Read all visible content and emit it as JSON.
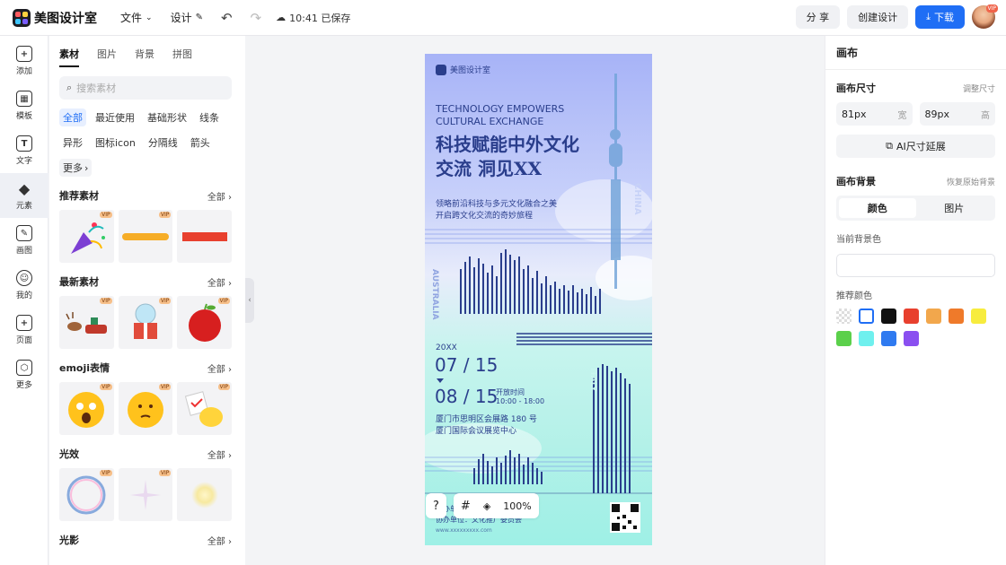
{
  "app": {
    "name": "美图设计室"
  },
  "topbar": {
    "file_label": "文件",
    "design_label": "设计",
    "saved_text": "10:41 已保存",
    "share_label": "分 享",
    "create_label": "创建设计",
    "download_label": "下载",
    "avatar_badge": "VIP"
  },
  "leftnav": {
    "items": [
      {
        "label": "添加",
        "icon": "plus-icon"
      },
      {
        "label": "模板",
        "icon": "template-icon"
      },
      {
        "label": "文字",
        "icon": "text-icon"
      },
      {
        "label": "元素",
        "icon": "shapes-icon"
      },
      {
        "label": "画图",
        "icon": "draw-icon"
      },
      {
        "label": "我的",
        "icon": "user-icon"
      },
      {
        "label": "页面",
        "icon": "page-icon"
      },
      {
        "label": "更多",
        "icon": "cube-icon"
      }
    ],
    "active": "元素"
  },
  "panel": {
    "tabs": [
      "素材",
      "图片",
      "背景",
      "拼图"
    ],
    "search_placeholder": "搜索素材",
    "chips": [
      "全部",
      "最近使用",
      "基础形状",
      "线条",
      "异形",
      "图标icon",
      "分隔线",
      "箭头",
      "更多"
    ],
    "all_label": "全部",
    "vip": "VIP",
    "sections": [
      "推荐素材",
      "最新素材",
      "emoji表情",
      "光效",
      "光影"
    ]
  },
  "canvas": {
    "poster": {
      "brand": "美图设计室",
      "en_line1": "TECHNOLOGY EMPOWERS",
      "en_line2": "CULTURAL EXCHANGE",
      "title_line1": "科技赋能中外文化",
      "title_line2": "交流  洞见XX",
      "desc_line1": "领略前沿科技与多元文化融合之美",
      "desc_line2": "开启跨文化交流的奇妙旅程",
      "side_left": "AUSTRALIA",
      "side_right": "CHINA",
      "side_mid": "ITALY",
      "year": "20XX",
      "date1": "07 / 15",
      "date2": "08 / 15",
      "time_label": "开放时间",
      "time_value": "10:00 - 18:00",
      "addr_line1": "厦门市思明区会展路 180 号",
      "addr_line2": "厦门国际会议展览中心",
      "host_line1": "主办单位：厦门文化交流协会",
      "host_line2": "协办单位：文化推广委员会",
      "small_line": "www.xxxxxxxxx.com"
    }
  },
  "zoom": {
    "value": "100%"
  },
  "help_label": "?",
  "rightpanel": {
    "title": "画布",
    "size_label": "画布尺寸",
    "resize_label": "调整尺寸",
    "width_value": "81px",
    "width_unit": "宽",
    "height_value": "89px",
    "height_unit": "高",
    "ai_label": "AI尺寸延展",
    "bg_label": "画布背景",
    "restore_label": "恢复原始背景",
    "seg_color": "颜色",
    "seg_image": "图片",
    "current_label": "当前背景色",
    "recommend_label": "推荐颜色",
    "swatches": [
      "#eeeeee",
      "#ffffff",
      "#111111",
      "#e8402e",
      "#f2a74c",
      "#ef7a2a",
      "#f7ec3e",
      "#5bd04b",
      "#6ff0ee",
      "#2f7af0",
      "#8a4ff0"
    ]
  }
}
